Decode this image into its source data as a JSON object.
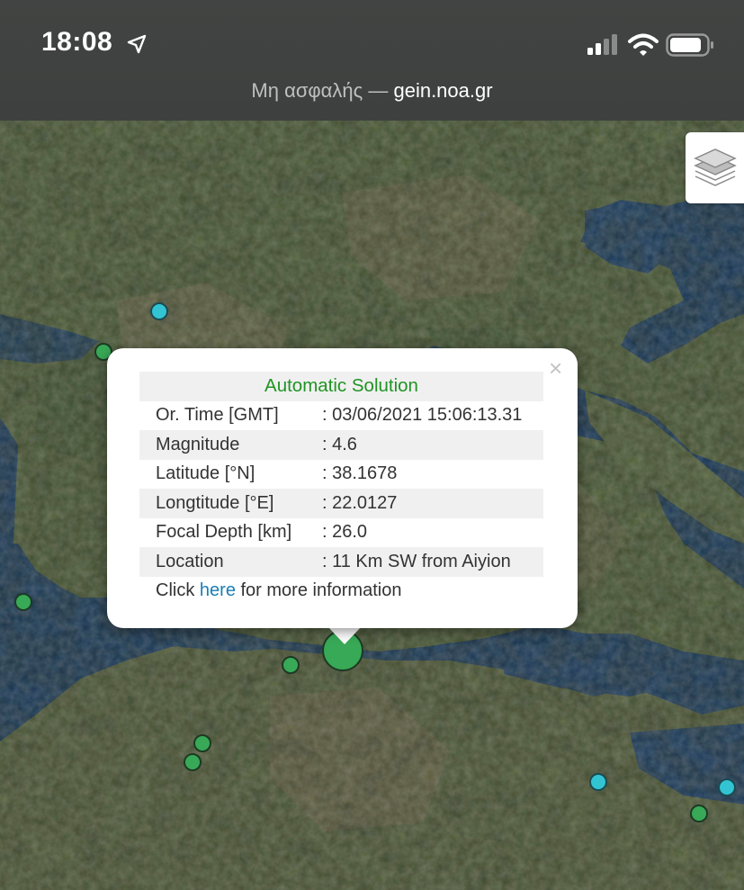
{
  "status_bar": {
    "time": "18:08",
    "location_icon": "location-arrow-icon",
    "signal_icon": "cellular-signal-icon",
    "wifi_icon": "wifi-icon",
    "battery_icon": "battery-icon"
  },
  "url_bar": {
    "security_label": "Μη ασφαλής",
    "separator": "—",
    "host": "gein.noa.gr"
  },
  "map": {
    "layers_icon": "layers-icon",
    "colors": {
      "major_event": "#38a957",
      "event_green": "#38a957",
      "event_cyan": "#33c4d3"
    }
  },
  "popup": {
    "title": "Automatic Solution",
    "close_label": "×",
    "rows": [
      {
        "label": "Or. Time [GMT]",
        "value": ": 03/06/2021 15:06:13.31"
      },
      {
        "label": "Magnitude",
        "value": ": 4.6"
      },
      {
        "label": "Latitude [°N]",
        "value": ": 38.1678"
      },
      {
        "label": "Longtitude [°E]",
        "value": ": 22.0127"
      },
      {
        "label": "Focal Depth [km]",
        "value": ": 26.0"
      },
      {
        "label": "Location",
        "value": ": 11 Km SW from Aiyion"
      }
    ],
    "more_prefix": "Click",
    "more_link": "here",
    "more_suffix": "for more information",
    "title_color": "#1f9423",
    "link_color": "#1a7fb5"
  }
}
